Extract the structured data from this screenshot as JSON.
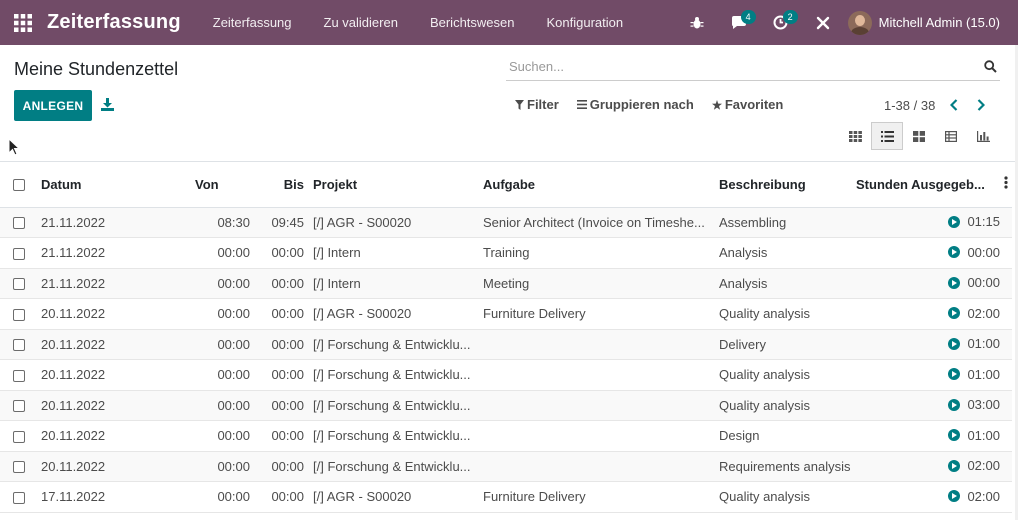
{
  "navbar": {
    "brand": "Zeiterfassung",
    "menu": [
      "Zeiterfassung",
      "Zu validieren",
      "Berichtswesen",
      "Konfiguration"
    ],
    "messages_badge": "4",
    "activities_badge": "2",
    "user_name": "Mitchell Admin (15.0)",
    "icons": [
      "apps-grid-icon",
      "bug-icon",
      "chat-icon",
      "clock-icon",
      "tools-icon"
    ],
    "background_color": "#714b67"
  },
  "control": {
    "title": "Meine Stundenzettel",
    "create_label": "ANLEGEN",
    "search_placeholder": "Suchen...",
    "filter_label": "Filter",
    "group_label": "Gruppieren nach",
    "favorites_label": "Favoriten",
    "pager": "1-38 / 38",
    "accent_color": "#017e84"
  },
  "table": {
    "headers": {
      "date": "Datum",
      "von": "Von",
      "bis": "Bis",
      "project": "Projekt",
      "task": "Aufgabe",
      "description": "Beschreibung",
      "hours": "Stunden Ausgegeb..."
    },
    "rows": [
      {
        "date": "21.11.2022",
        "von": "08:30",
        "bis": "09:45",
        "project": "[/] AGR - S00020",
        "task": "Senior Architect (Invoice on Timeshe...",
        "description": "Assembling",
        "hours": "01:15"
      },
      {
        "date": "21.11.2022",
        "von": "00:00",
        "bis": "00:00",
        "project": "[/] Intern",
        "task": "Training",
        "description": "Analysis",
        "hours": "00:00"
      },
      {
        "date": "21.11.2022",
        "von": "00:00",
        "bis": "00:00",
        "project": "[/] Intern",
        "task": "Meeting",
        "description": "Analysis",
        "hours": "00:00"
      },
      {
        "date": "20.11.2022",
        "von": "00:00",
        "bis": "00:00",
        "project": "[/] AGR - S00020",
        "task": "Furniture Delivery",
        "description": "Quality analysis",
        "hours": "02:00"
      },
      {
        "date": "20.11.2022",
        "von": "00:00",
        "bis": "00:00",
        "project": "[/] Forschung & Entwicklu...",
        "task": "",
        "description": "Delivery",
        "hours": "01:00"
      },
      {
        "date": "20.11.2022",
        "von": "00:00",
        "bis": "00:00",
        "project": "[/] Forschung & Entwicklu...",
        "task": "",
        "description": "Quality analysis",
        "hours": "01:00"
      },
      {
        "date": "20.11.2022",
        "von": "00:00",
        "bis": "00:00",
        "project": "[/] Forschung & Entwicklu...",
        "task": "",
        "description": "Quality analysis",
        "hours": "03:00"
      },
      {
        "date": "20.11.2022",
        "von": "00:00",
        "bis": "00:00",
        "project": "[/] Forschung & Entwicklu...",
        "task": "",
        "description": "Design",
        "hours": "01:00"
      },
      {
        "date": "20.11.2022",
        "von": "00:00",
        "bis": "00:00",
        "project": "[/] Forschung & Entwicklu...",
        "task": "",
        "description": "Requirements analysis",
        "hours": "02:00"
      },
      {
        "date": "17.11.2022",
        "von": "00:00",
        "bis": "00:00",
        "project": "[/] AGR - S00020",
        "task": "Furniture Delivery",
        "description": "Quality analysis",
        "hours": "02:00"
      }
    ]
  }
}
